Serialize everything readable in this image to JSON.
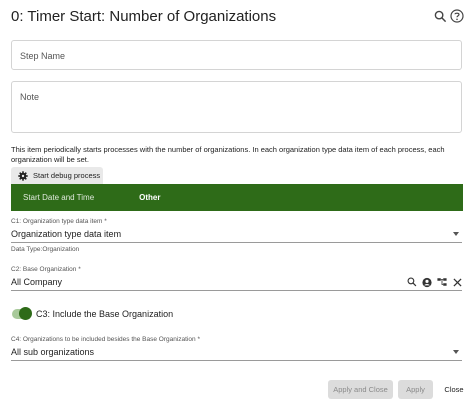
{
  "dialog": {
    "title": "0: Timer Start: Number of Organizations",
    "header_icons": [
      "search-icon",
      "help-icon"
    ]
  },
  "step_name": {
    "placeholder": "Step Name",
    "value": ""
  },
  "note": {
    "placeholder": "Note",
    "value": ""
  },
  "description": "This item periodically starts processes with the number of organizations. In each organization type data item of each process, each organization will be set.",
  "debug_button": {
    "label": "Start debug process",
    "icon": "gear-icon"
  },
  "tabs": [
    {
      "label": "Start Date and Time",
      "active": false
    },
    {
      "label": "Other",
      "active": true
    }
  ],
  "c1": {
    "label": "C1: Organization type data item *",
    "value": "Organization type data item",
    "hint": "Data Type:Organization"
  },
  "c2": {
    "label": "C2: Base Organization *",
    "value": "All Company",
    "icons": [
      "search-icon",
      "user-icon",
      "org-chart-icon",
      "clear-icon"
    ]
  },
  "c3": {
    "label": "C3: Include the Base Organization",
    "checked": true
  },
  "c4": {
    "label": "C4: Organizations to be included besides the Base Organization *",
    "value": "All sub organizations"
  },
  "footer": {
    "apply_close": "Apply and Close",
    "apply": "Apply",
    "close": "Close"
  },
  "colors": {
    "accent": "#2e6b18",
    "toggle_track": "#a8c99a"
  }
}
